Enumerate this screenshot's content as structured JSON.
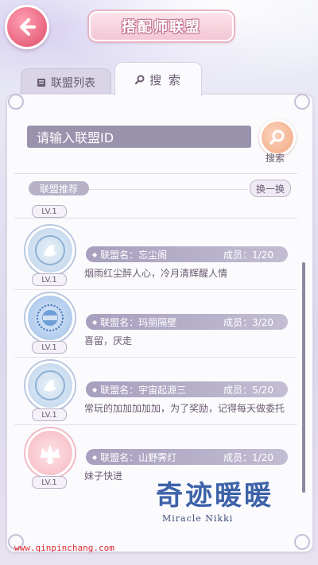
{
  "header": {
    "title": "搭配师联盟",
    "back_icon": "arrow-left-icon"
  },
  "tabs": [
    {
      "label": "联盟列表",
      "icon": "book-icon",
      "active": false
    },
    {
      "label": "搜 索",
      "icon": "magnifier-icon",
      "active": true
    }
  ],
  "search": {
    "placeholder": "请输入联盟ID",
    "button_label": "搜索"
  },
  "recommend": {
    "section_label": "联盟推荐",
    "refresh_label": "换一换",
    "partial_level": "LV.1",
    "guilds": [
      {
        "name": "联盟名：忘尘阁",
        "members": "成员：1/20",
        "level": "LV.1",
        "desc": "烟雨红尘醉人心，冷月清辉醒人情",
        "emblem": "swan-emblem",
        "emblem_color": "#bcd3ea"
      },
      {
        "name": "联盟名：玛丽隔壁",
        "members": "成员：3/20",
        "level": "LV.1",
        "desc": "喜留，厌走",
        "emblem": "clock-emblem",
        "emblem_color": "#9fc0e8"
      },
      {
        "name": "联盟名：宇宙起源三",
        "members": "成员：5/20",
        "level": "LV.1",
        "desc": "常玩的加加加加加，为了奖励，记得每天做委托",
        "emblem": "swan-emblem",
        "emblem_color": "#bcd3ea"
      },
      {
        "name": "联盟名：山野霁灯",
        "members": "成员：1/20",
        "level": "LV.1",
        "desc": "妹子快进",
        "emblem": "crown-emblem",
        "emblem_color": "#f6b7c0"
      }
    ]
  },
  "logo": {
    "cn": "奇迹暖暖",
    "en": "Miracle Nikki"
  },
  "watermark": "www.qinpinchang.com"
}
